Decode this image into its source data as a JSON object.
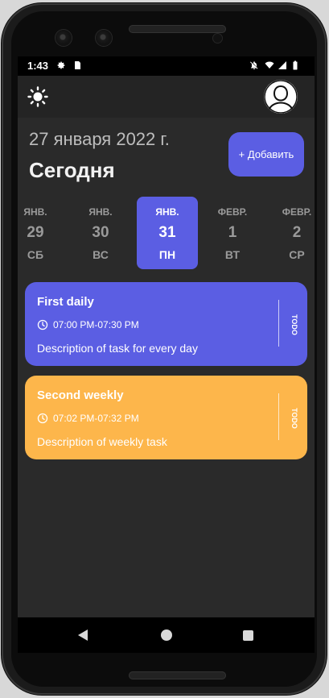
{
  "status_bar": {
    "time": "1:43"
  },
  "header": {
    "date": "27 января 2022 г.",
    "title": "Сегодня",
    "add_button": "+ Добавить"
  },
  "date_strip": [
    {
      "month": "ЯНВ.",
      "day": "29",
      "weekday": "СБ",
      "selected": false
    },
    {
      "month": "ЯНВ.",
      "day": "30",
      "weekday": "ВС",
      "selected": false
    },
    {
      "month": "ЯНВ.",
      "day": "31",
      "weekday": "ПН",
      "selected": true
    },
    {
      "month": "ФЕВР.",
      "day": "1",
      "weekday": "ВТ",
      "selected": false
    },
    {
      "month": "ФЕВР.",
      "day": "2",
      "weekday": "СР",
      "selected": false
    }
  ],
  "tasks": [
    {
      "title": "First daily",
      "time": "07:00 PM-07:30 PM",
      "description": "Description of task for every day",
      "status": "TODO",
      "color": "#5b5ee3"
    },
    {
      "title": "Second weekly",
      "time": "07:02 PM-07:32 PM",
      "description": "Description of weekly task",
      "status": "TODO",
      "color": "#fdb64b"
    }
  ],
  "icons": {
    "theme": "sun-icon",
    "profile": "person-avatar-icon",
    "settings": "gear-icon",
    "sd_card": "sd-card-icon",
    "mute": "notifications-off-icon",
    "wifi": "wifi-icon",
    "signal": "signal-icon",
    "battery": "battery-icon",
    "clock": "clock-icon",
    "nav_back": "back-triangle-icon",
    "nav_home": "home-circle-icon",
    "nav_recent": "recent-apps-square-icon"
  }
}
